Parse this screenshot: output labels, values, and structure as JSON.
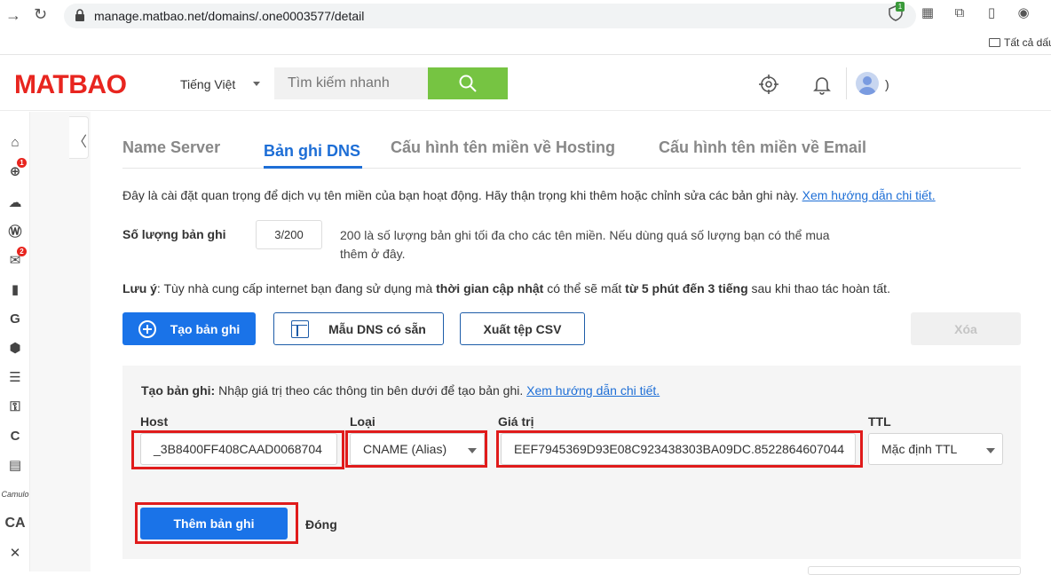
{
  "browser": {
    "url": "manage.matbao.net/domains/.one0003577/detail",
    "ext_badge": "1",
    "bookmark_folder": "Tất cả dấu"
  },
  "header": {
    "logo": "MATBAO",
    "language": "Tiếng Việt",
    "search_placeholder": "Tìm kiếm nhanh",
    "account_suffix": ")"
  },
  "sidebar": {
    "badges": {
      "domains": "1",
      "email": "2"
    },
    "items": [
      "home-icon",
      "globe-icon",
      "cloud-icon",
      "wordpress-icon",
      "mail-icon",
      "office-icon",
      "google-icon",
      "hexagon-icon",
      "server-icon",
      "security-icon",
      "c-icon",
      "document-icon",
      "script-icon",
      "ca-icon",
      "tools-icon"
    ]
  },
  "tabs": [
    {
      "label": "Name Server",
      "active": false
    },
    {
      "label": "Bản ghi DNS",
      "active": true
    },
    {
      "label": "Cấu hình tên miền về Hosting",
      "active": false
    },
    {
      "label": "Cấu hình tên miền về Email",
      "active": false
    }
  ],
  "intro": {
    "text": "Đây là cài đặt quan trọng để dịch vụ tên miền của bạn hoạt động. Hãy thận trọng khi thêm hoặc chỉnh sửa các bản ghi này. ",
    "link": "Xem hướng dẫn chi tiết."
  },
  "record_count": {
    "label": "Số lượng bản ghi",
    "value": "3/200",
    "note": "200 là số lượng bản ghi tối đa cho các tên miền. Nếu dùng quá số lượng bạn có thể mua thêm ở đây."
  },
  "notice": {
    "prefix": "Lưu ý",
    "part1": ": Tùy nhà cung cấp internet bạn đang sử dụng mà ",
    "bold1": "thời gian cập nhật",
    "part2": " có thể sẽ mất ",
    "bold2": "từ 5 phút đến 3 tiếng",
    "part3": " sau khi thao tác hoàn tất."
  },
  "actions": {
    "create": "Tạo bản ghi",
    "template": "Mẫu DNS có sẵn",
    "export_csv": "Xuất tệp CSV",
    "delete": "Xóa"
  },
  "create_panel": {
    "title_bold": "Tạo bản ghi:",
    "title_text": " Nhập giá trị theo các thông tin bên dưới để tạo bản ghi. ",
    "title_link": "Xem hướng dẫn chi tiết.",
    "host_label": "Host",
    "host_value": "_3B8400FF408CAAD0068704",
    "type_label": "Loại",
    "type_value": "CNAME (Alias)",
    "value_label": "Giá trị",
    "value_value": "EEF7945369D93E08C923438303BA09DC.8522864607044",
    "ttl_label": "TTL",
    "ttl_value": "Mặc định TTL",
    "add_button": "Thêm bản ghi",
    "close_button": "Đóng"
  },
  "colors": {
    "brand": "#e8251f",
    "primary": "#1a73e8",
    "search_green": "#76c442",
    "highlight": "#e01b1b"
  }
}
